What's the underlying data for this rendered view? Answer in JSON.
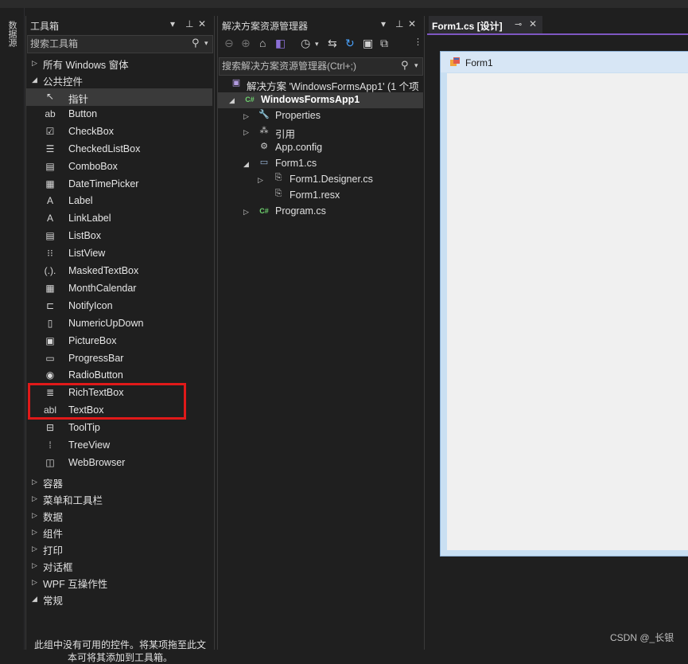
{
  "left_rail": {
    "label": "数据源"
  },
  "toolbox": {
    "title": "工具箱",
    "search_placeholder": "搜索工具箱",
    "categories_top": [
      {
        "label": "所有 Windows 窗体",
        "expanded": false
      },
      {
        "label": "公共控件",
        "expanded": true
      }
    ],
    "items": [
      {
        "label": "指针",
        "icon": "pointer-icon",
        "glyph": "↖",
        "selected": true
      },
      {
        "label": "Button",
        "icon": "button-icon",
        "glyph": "ab"
      },
      {
        "label": "CheckBox",
        "icon": "checkbox-icon",
        "glyph": "☑"
      },
      {
        "label": "CheckedListBox",
        "icon": "checked-list-icon",
        "glyph": "☰"
      },
      {
        "label": "ComboBox",
        "icon": "combobox-icon",
        "glyph": "▤"
      },
      {
        "label": "DateTimePicker",
        "icon": "calendar-icon",
        "glyph": "▦"
      },
      {
        "label": "Label",
        "icon": "label-icon",
        "glyph": "A"
      },
      {
        "label": "LinkLabel",
        "icon": "linklabel-icon",
        "glyph": "A"
      },
      {
        "label": "ListBox",
        "icon": "listbox-icon",
        "glyph": "▤"
      },
      {
        "label": "ListView",
        "icon": "listview-icon",
        "glyph": "⁝⁝"
      },
      {
        "label": "MaskedTextBox",
        "icon": "masked-textbox-icon",
        "glyph": "(.)."
      },
      {
        "label": "MonthCalendar",
        "icon": "month-calendar-icon",
        "glyph": "▦"
      },
      {
        "label": "NotifyIcon",
        "icon": "notify-icon",
        "glyph": "⊏"
      },
      {
        "label": "NumericUpDown",
        "icon": "numeric-updown-icon",
        "glyph": "▯"
      },
      {
        "label": "PictureBox",
        "icon": "picturebox-icon",
        "glyph": "▣"
      },
      {
        "label": "ProgressBar",
        "icon": "progressbar-icon",
        "glyph": "▭"
      },
      {
        "label": "RadioButton",
        "icon": "radiobutton-icon",
        "glyph": "◉"
      },
      {
        "label": "RichTextBox",
        "icon": "richtextbox-icon",
        "glyph": "≣"
      },
      {
        "label": "TextBox",
        "icon": "textbox-icon",
        "glyph": "abl"
      },
      {
        "label": "ToolTip",
        "icon": "tooltip-icon",
        "glyph": "⊟"
      },
      {
        "label": "TreeView",
        "icon": "treeview-icon",
        "glyph": "⁞"
      },
      {
        "label": "WebBrowser",
        "icon": "webbrowser-icon",
        "glyph": "◫"
      }
    ],
    "categories_bottom": [
      {
        "label": "容器",
        "expanded": false
      },
      {
        "label": "菜单和工具栏",
        "expanded": false
      },
      {
        "label": "数据",
        "expanded": false
      },
      {
        "label": "组件",
        "expanded": false
      },
      {
        "label": "打印",
        "expanded": false
      },
      {
        "label": "对话框",
        "expanded": false
      },
      {
        "label": "WPF 互操作性",
        "expanded": false
      },
      {
        "label": "常规",
        "expanded": true
      }
    ],
    "empty_note": "此组中没有可用的控件。将某项拖至此文本可将其添加到工具箱。"
  },
  "solution_explorer": {
    "title": "解决方案资源管理器",
    "search_placeholder": "搜索解决方案资源管理器(Ctrl+;)",
    "nodes": [
      {
        "label": "解决方案 'WindowsFormsApp1' (1 个项",
        "icon": "solution-icon",
        "depth": 0,
        "expander": "",
        "bold": false
      },
      {
        "label": "WindowsFormsApp1",
        "icon": "csharp-project-icon",
        "depth": 0,
        "expander": "◢",
        "bold": true,
        "selected": true
      },
      {
        "label": "Properties",
        "icon": "wrench-icon",
        "depth": 1,
        "expander": "▷",
        "bold": false
      },
      {
        "label": "引用",
        "icon": "references-icon",
        "depth": 1,
        "expander": "▷",
        "bold": false
      },
      {
        "label": "App.config",
        "icon": "config-file-icon",
        "depth": 1,
        "expander": "",
        "bold": false
      },
      {
        "label": "Form1.cs",
        "icon": "form-icon",
        "depth": 1,
        "expander": "◢",
        "bold": false
      },
      {
        "label": "Form1.Designer.cs",
        "icon": "cs-file-icon",
        "depth": 2,
        "expander": "▷",
        "bold": false
      },
      {
        "label": "Form1.resx",
        "icon": "resx-file-icon",
        "depth": 2,
        "expander": "",
        "bold": false
      },
      {
        "label": "Program.cs",
        "icon": "csharp-file-icon",
        "depth": 1,
        "expander": "▷",
        "bold": false
      }
    ]
  },
  "designer": {
    "tab_label": "Form1.cs [设计]",
    "form_title": "Form1"
  },
  "watermark": "CSDN @_长银",
  "colors": {
    "accent": "#7e57c2",
    "highlight_box": "#e01919",
    "panel_bg": "#1f1f1f"
  }
}
